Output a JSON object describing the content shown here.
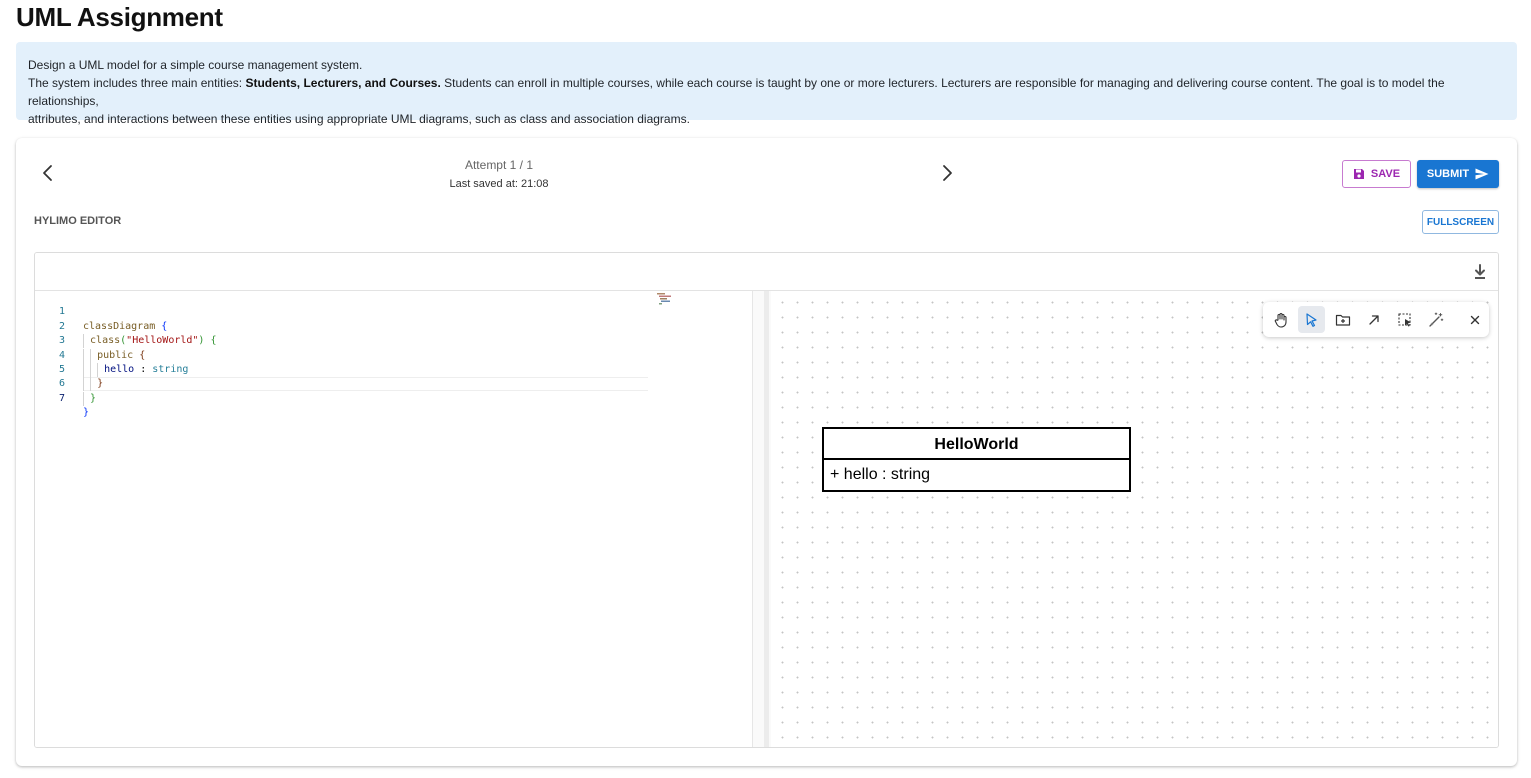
{
  "page": {
    "title": "UML Assignment"
  },
  "description": {
    "line1": "Design a UML model for a simple course management system.",
    "line2_prefix": "The system includes three main entities: ",
    "line2_bold": "Students, Lecturers, and Courses.",
    "line2_suffix": " Students can enroll in multiple courses, while each course is taught by one or more lecturers. Lecturers are responsible for managing and delivering course content. The goal is to model the relationships,",
    "line3": "attributes, and interactions between these entities using appropriate UML diagrams, such as class and association diagrams."
  },
  "header": {
    "attempt": "Attempt 1 / 1",
    "last_saved": "Last saved at: 21:08",
    "save_label": "SAVE",
    "submit_label": "SUBMIT"
  },
  "editor": {
    "label": "HYLIMO EDITOR",
    "fullscreen_label": "FULLSCREEN"
  },
  "code": {
    "line_numbers": [
      "1",
      "2",
      "3",
      "4",
      "5",
      "6",
      "7"
    ],
    "tokens": {
      "class_diagram": "classDiagram",
      "class_fn": "class",
      "class_name": "\"HelloWorld\"",
      "public": "public",
      "field": "hello",
      "colon": " : ",
      "type": "string",
      "open_brace": "{",
      "close_brace": "}",
      "open_paren": "(",
      "close_paren": ")"
    }
  },
  "diagram": {
    "class_name": "HelloWorld",
    "attribute": "+ hello : string"
  },
  "toolbar": {
    "tools": [
      "hand-icon",
      "select-pointer-icon",
      "add-element-icon",
      "connection-arrow-icon",
      "box-select-icon",
      "magic-wand-icon",
      "close-icon"
    ],
    "selected": "select-pointer-icon"
  },
  "colors": {
    "accent": "#1976d2",
    "save": "#9c27b0",
    "description_bg": "#e3f0fb"
  }
}
